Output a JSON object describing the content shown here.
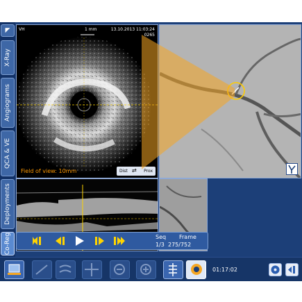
{
  "tabs": {
    "top": "",
    "items": [
      {
        "label": "X-Ray"
      },
      {
        "label": "Angiograms"
      },
      {
        "label": "QCA & VE"
      },
      {
        "label": "Deployments"
      },
      {
        "label": "Co-Reg"
      }
    ],
    "active_index": 4
  },
  "ivus": {
    "corner_label": "VH",
    "scale_label": "1 mm",
    "datetime": "13.10.2013 11:03:24",
    "frame_id": "0265",
    "field_of_view": "Field of view: 10mm",
    "dist_label": "Dist",
    "prox_label": "Prox"
  },
  "transport": {
    "seq_label": "Seq",
    "frame_label": "Frame",
    "seq_value": "1/3",
    "frame_value": "275/752",
    "buttons": [
      "first-frame",
      "step-back",
      "play",
      "step-forward",
      "last-frame"
    ]
  },
  "toolbar": {
    "time": "01:17:02"
  },
  "colors": {
    "accent": "#f5a623",
    "panel_bg": "#1c3f78",
    "tab_active": "#5a8ad0"
  }
}
